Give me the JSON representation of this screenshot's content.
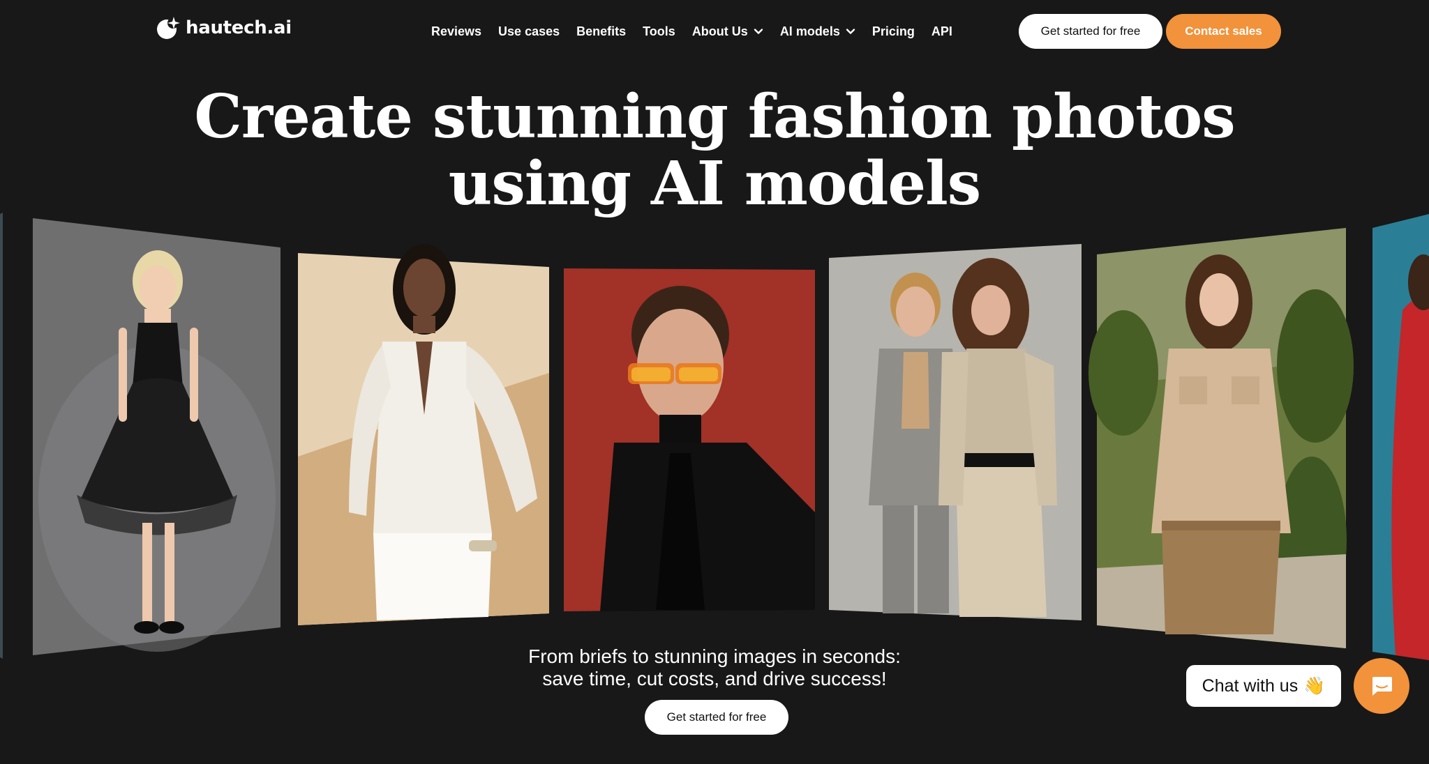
{
  "brand": {
    "name": "hautech.ai",
    "logo_icon": "spark-circle-icon",
    "accent": "#f2923a",
    "background": "#181818"
  },
  "nav": {
    "items": [
      {
        "label": "Reviews",
        "dropdown": false
      },
      {
        "label": "Use cases",
        "dropdown": false
      },
      {
        "label": "Benefits",
        "dropdown": false
      },
      {
        "label": "Tools",
        "dropdown": false
      },
      {
        "label": "About Us",
        "dropdown": true
      },
      {
        "label": "AI models",
        "dropdown": true
      },
      {
        "label": "Pricing",
        "dropdown": false
      },
      {
        "label": "API",
        "dropdown": false
      }
    ]
  },
  "header_actions": {
    "get_started_label": "Get started for free",
    "contact_label": "Contact sales"
  },
  "hero": {
    "headline_line1": "Create stunning fashion photos",
    "headline_line2": "using AI models"
  },
  "carousel": {
    "slides": [
      {
        "subject": "girl in black tulle dress",
        "bg": "#727272"
      },
      {
        "subject": "woman in white blouse and skirt",
        "bg": "#d8bd96"
      },
      {
        "subject": "man with orange glasses and black turtleneck",
        "bg": "#a23127"
      },
      {
        "subject": "couple in beige suits",
        "bg": "#b3b1aa"
      },
      {
        "subject": "woman in beige shirt with palms",
        "bg": "#5f6e3a"
      }
    ]
  },
  "subline": {
    "line1": "From briefs to stunning images in seconds:",
    "line2": "save time, cut costs, and drive success!"
  },
  "cta": {
    "label": "Get started for free"
  },
  "chat": {
    "label": "Chat with us",
    "emoji": "👋",
    "launcher_icon": "chat-bubble-icon"
  }
}
